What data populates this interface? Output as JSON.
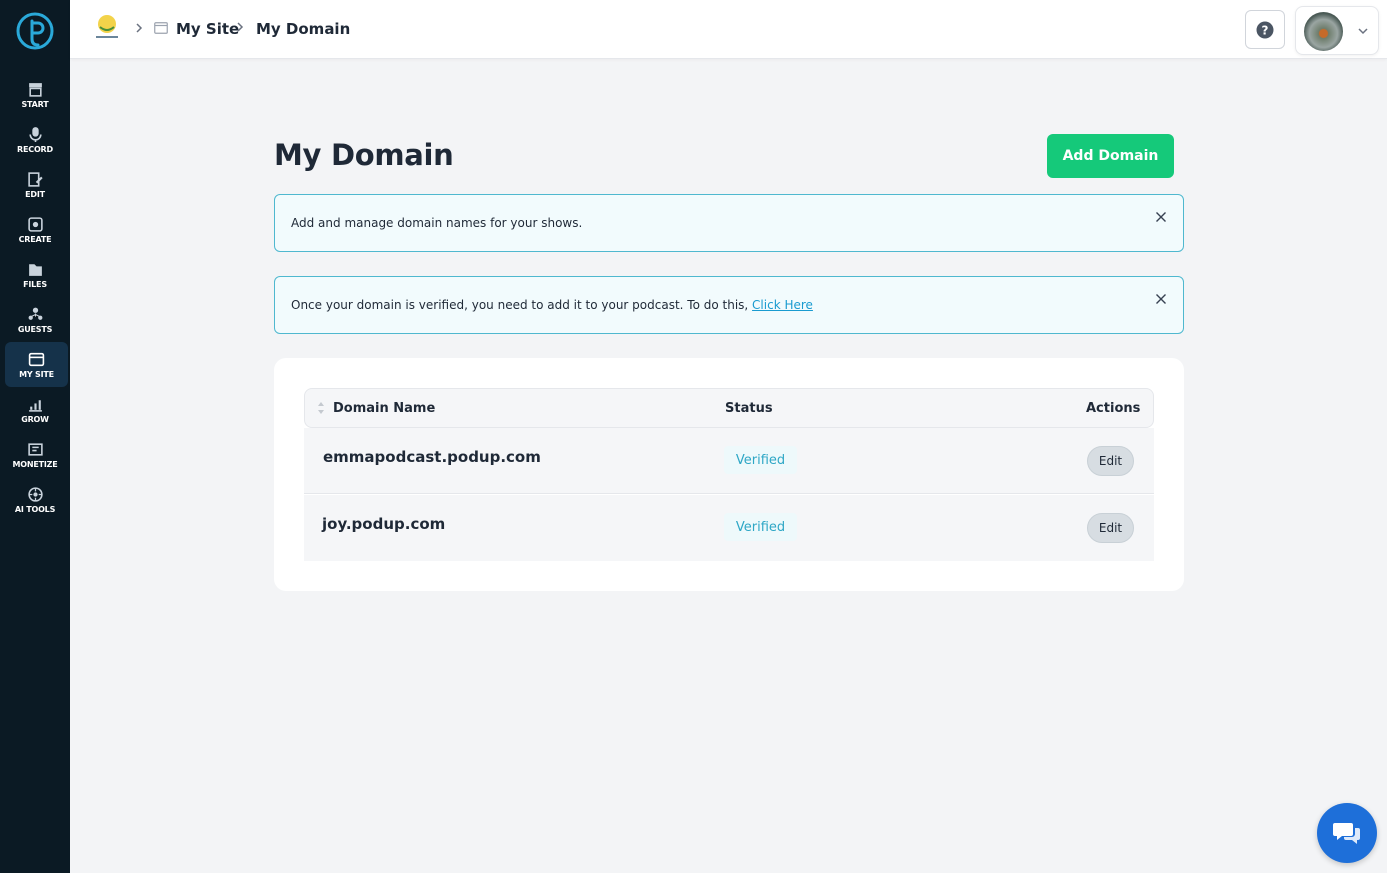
{
  "sidebar": {
    "items": [
      {
        "label": "START",
        "icon": "start-icon"
      },
      {
        "label": "RECORD",
        "icon": "microphone-icon"
      },
      {
        "label": "EDIT",
        "icon": "edit-icon"
      },
      {
        "label": "CREATE",
        "icon": "create-icon"
      },
      {
        "label": "FILES",
        "icon": "files-icon"
      },
      {
        "label": "GUESTS",
        "icon": "guests-icon"
      },
      {
        "label": "MY SITE",
        "icon": "my-site-icon",
        "active": true
      },
      {
        "label": "GROW",
        "icon": "grow-icon"
      },
      {
        "label": "MONETIZE",
        "icon": "monetize-icon"
      },
      {
        "label": "AI TOOLS",
        "icon": "ai-tools-icon"
      }
    ]
  },
  "breadcrumb": {
    "items": [
      "My Site",
      "My Domain"
    ]
  },
  "main": {
    "title": "My Domain",
    "add_button_label": "Add Domain",
    "alerts": [
      {
        "text": "Add and manage domain names for your shows."
      },
      {
        "text": "Once your domain is verified, you need to add it to your podcast. To do this, ",
        "link": "Click Here"
      }
    ],
    "table": {
      "columns": [
        "Domain Name",
        "Status",
        "Actions"
      ],
      "rows": [
        {
          "domain": "emmapodcast.podup.com",
          "status": "Verified",
          "action": "Edit"
        },
        {
          "domain": "joy.podup.com",
          "status": "Verified",
          "action": "Edit"
        }
      ]
    }
  },
  "colors": {
    "sidebar_bg": "#0b1a24",
    "accent_green": "#15c97a",
    "alert_border": "#4fb8cf",
    "link": "#1a9bd0",
    "chat_blue": "#1e6fd9"
  }
}
